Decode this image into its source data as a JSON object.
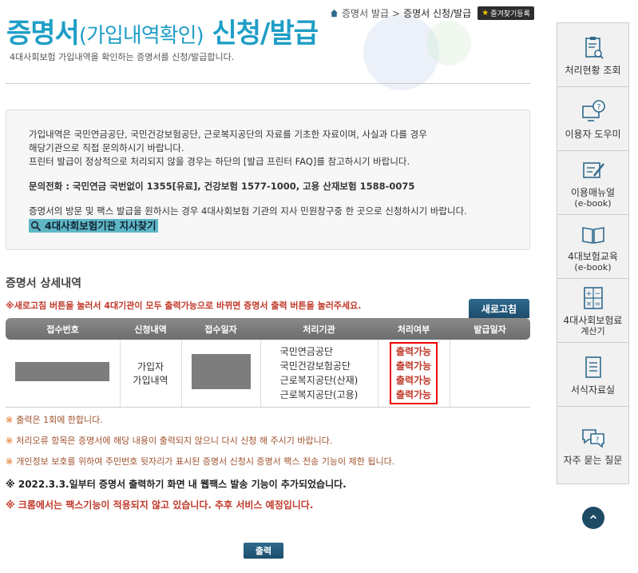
{
  "breadcrumb": {
    "parent": "증명서 발급",
    "separator": ">",
    "current": "증명서 신청/발급",
    "favorite_label": "즐겨찾기등록"
  },
  "page": {
    "title_main": "증명서",
    "title_paren": "(가입내역확인)",
    "title_rest": " 신청/발급",
    "description": "4대사회보험 가입내역을 확인하는 증명서를 신청/발급합니다."
  },
  "notice": {
    "line1": "가입내역은 국민연금공단, 국민건강보험공단, 근로복지공단의 자료를 기초한 자료이며, 사실과 다를 경우",
    "line2": "해당기관으로 직접 문의하시기 바랍니다.",
    "line3": "프린터 발급이 정상적으로 처리되지 않을 경우는 하단의 [발급 프린터 FAQ]를 참고하시기 바랍니다.",
    "phone": "문의전화 : 국민연금 국번없이 1355[유료], 건강보험 1577-1000, 고용 산재보험 1588-0075",
    "visit": "증명서의 방문 및 팩스 발급을 원하시는 경우 4대사회보험 기관의 지사 민원창구중 한 곳으로 신청하시기 바랍니다.",
    "branch_link": "4대사회보험기관 지사찾기"
  },
  "section": {
    "title": "증명서 상세내역",
    "red_note": "※새로고침 버튼을 눌러서 4대기관이 모두 출력가능으로 바뀌면 증명서 출력 버튼을 눌러주세요.",
    "refresh_label": "새로고침"
  },
  "table": {
    "headers": [
      "접수번호",
      "신청내역",
      "접수일자",
      "처리기관",
      "처리여부",
      "발급일자"
    ],
    "row": {
      "request_line1": "가입자",
      "request_line2": "가입내역",
      "agencies": [
        "국민연금공단",
        "국민건강보험공단",
        "근로복지공단(산재)",
        "근로복지공단(고용)"
      ],
      "statuses": [
        "출력가능",
        "출력가능",
        "출력가능",
        "출력가능"
      ]
    }
  },
  "notes": {
    "mark": "※",
    "n1": "출력은 1회에 한합니다.",
    "n2": "처리오류 항목은 증명서에 해당 내용이 출력되지 않으니 다시 신청 해 주시기 바랍니다.",
    "n3": "개인정보 보호를 위하여 주민번호 뒷자리가 표시된 증명서 신청시 증명서 팩스 전송 기능이 제한 됩니다.",
    "n4": "※ 2022.3.3.일부터 증명서 출력하기 화면 내 웹팩스 발송 기능이 추가되었습니다.",
    "n5": "※ 크롬에서는 팩스기능이 적용되지 않고 있습니다. 추후 서비스 예정입니다."
  },
  "print_label": "출력",
  "side_menu": [
    {
      "label": "처리현황 조회",
      "sub": "",
      "icon": "clipboard-search-icon"
    },
    {
      "label": "이용자 도우미",
      "sub": "",
      "icon": "help-monitor-icon"
    },
    {
      "label": "이용매뉴얼",
      "sub": "(e-book)",
      "icon": "manual-pen-icon"
    },
    {
      "label": "4대보험교육",
      "sub": "(e-book)",
      "icon": "book-icon"
    },
    {
      "label": "4대사회보험료",
      "sub": "계산기",
      "icon": "calculator-icon"
    },
    {
      "label": "서식자료실",
      "sub": "",
      "icon": "document-list-icon"
    },
    {
      "label": "자주 묻는 질문",
      "sub": "",
      "icon": "chat-question-icon"
    }
  ],
  "colors": {
    "title": "#1f9ec6",
    "status_red": "#c0392b",
    "button_navy": "#1d4d6c",
    "header_gray": "#7a7a7a"
  }
}
